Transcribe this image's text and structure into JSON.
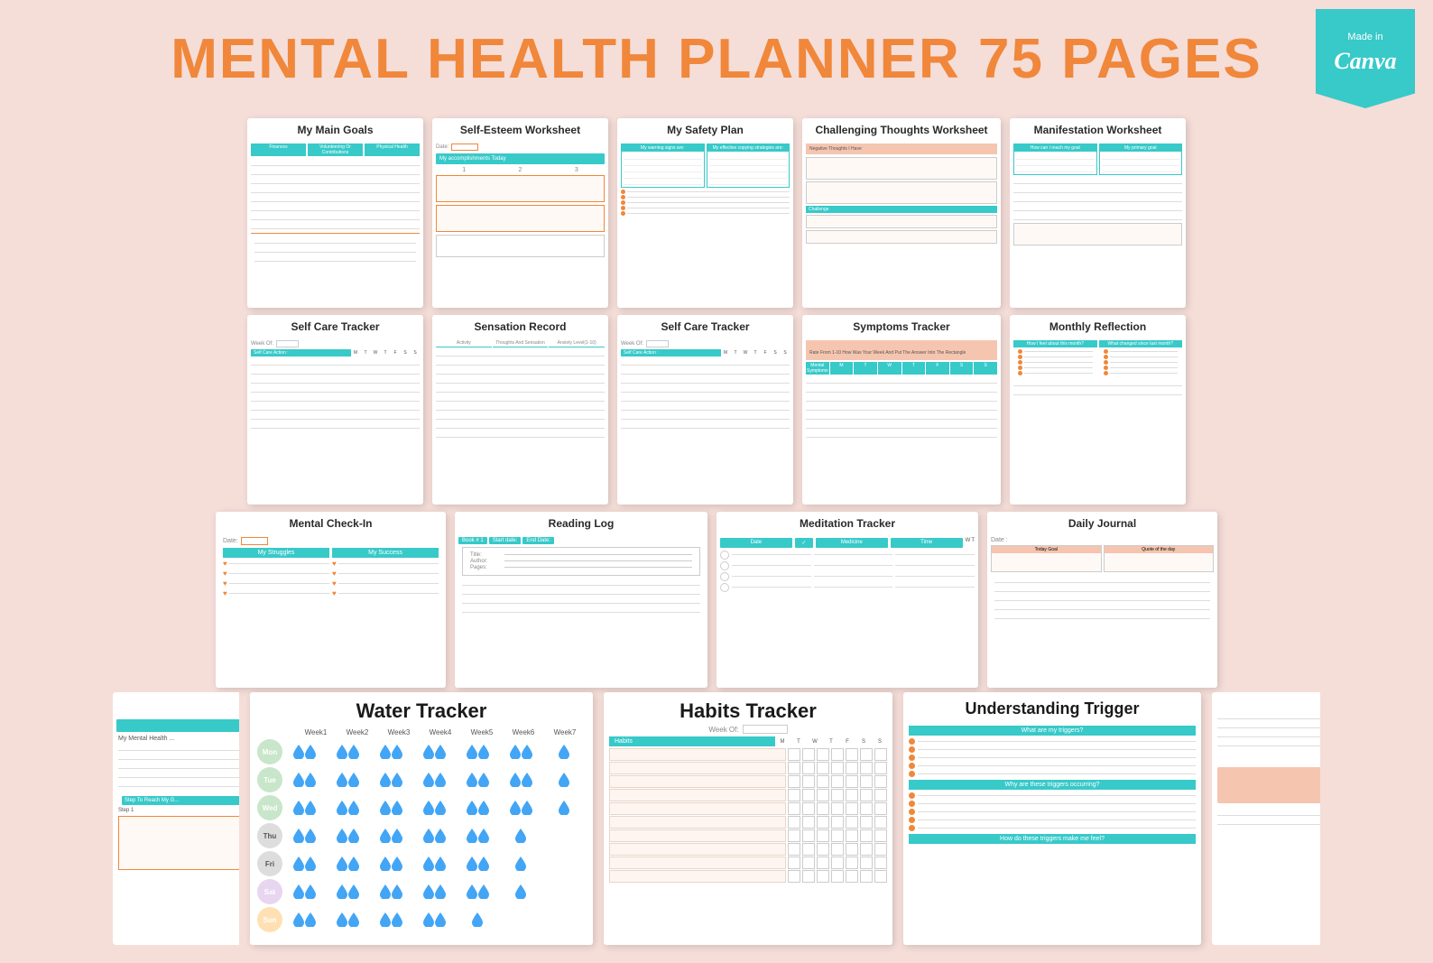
{
  "header": {
    "title_black": "MENTAL HEALTH PLANNER",
    "title_orange": "75 PAGES",
    "canva_badge": {
      "made_in": "Made in",
      "canva": "Canva"
    }
  },
  "cards": {
    "row1": [
      {
        "id": "my-main-goals",
        "title": "My Main Goals"
      },
      {
        "id": "self-esteem-worksheet",
        "title": "Self-Esteem Worksheet"
      },
      {
        "id": "my-safety-plan",
        "title": "My Safety Plan"
      },
      {
        "id": "challenging-thoughts",
        "title": "Challenging Thoughts Worksheet"
      },
      {
        "id": "manifestation-worksheet",
        "title": "Manifestation Worksheet"
      }
    ],
    "row2": [
      {
        "id": "self-care-tracker-1",
        "title": "Self Care Tracker"
      },
      {
        "id": "sensation-record",
        "title": "Sensation Record"
      },
      {
        "id": "self-care-tracker-2",
        "title": "Self Care Tracker"
      },
      {
        "id": "symptoms-tracker",
        "title": "Symptoms Tracker"
      },
      {
        "id": "monthly-reflection",
        "title": "Monthly Reflection"
      }
    ],
    "row3": [
      {
        "id": "mental-check-in",
        "title": "Mental Check-In"
      },
      {
        "id": "reading-log",
        "title": "Reading Log"
      },
      {
        "id": "meditation-tracker",
        "title": "Meditation Tracker"
      },
      {
        "id": "daily-journal",
        "title": "Daily Journal"
      }
    ],
    "row4": [
      {
        "id": "water-tracker",
        "title": "Water Tracker"
      },
      {
        "id": "habits-tracker",
        "title": "Habits Tracker"
      },
      {
        "id": "understanding-trigger",
        "title": "Understanding Trigger"
      }
    ]
  },
  "water_tracker": {
    "title": "Water Tracker",
    "weeks": [
      "Week1",
      "Week2",
      "Week3",
      "Week4",
      "Week5",
      "Week6",
      "Week7"
    ],
    "days": [
      "Mon",
      "Tue",
      "Wed",
      "Thu",
      "Fri",
      "Sat",
      "Sun"
    ]
  },
  "habits_tracker": {
    "title": "Habits Tracker",
    "week_of_label": "Week Of:",
    "habits_label": "Habits",
    "days": [
      "M",
      "T",
      "W",
      "T",
      "F",
      "S",
      "S"
    ]
  },
  "understanding_trigger": {
    "title": "Understanding Trigger",
    "question1": "What are my triggers?",
    "question2": "Why are these triggers occurring?",
    "question3": "How do these triggers make me feel?"
  },
  "symptoms_tracker": {
    "description": "Rate From 1-10 How Was Your Week And Put The Answer Into The Rectangle",
    "label": "Mental Symptoms"
  },
  "monthly_reflection": {
    "col1": "How I feel about this month?",
    "col2": "What changed since last month?"
  },
  "self_esteem": {
    "date_label": "Date:",
    "accomplishments_label": "My accomplishments Today",
    "numbers": [
      "1",
      "2",
      "3"
    ]
  },
  "safety_plan": {
    "col1_header": "My warning signs are:",
    "col2_header": "My effective copying strategies are:"
  },
  "manifestation": {
    "col1": "How can I reach my goal",
    "col2": "My primary goal"
  },
  "reading_log": {
    "book_label": "Book # 1",
    "start_label": "Start date:",
    "end_label": "End Date:",
    "fields": [
      "Title:",
      "Author:",
      "Pages:"
    ]
  },
  "meditation": {
    "col1": "Date",
    "col2": "Medicine",
    "col3": "Time"
  },
  "daily_journal": {
    "date_label": "Date :",
    "col1": "Today Goal",
    "col2": "Quote of the day"
  },
  "mental_checkin": {
    "date_label": "Date:",
    "col1": "My Struggles",
    "col2": "My Success"
  },
  "sensation_record": {
    "cols": [
      "Activity",
      "Thoughts And Sensation",
      "Anxiety Level(1-10)"
    ]
  },
  "self_care": {
    "week_label": "Week Of:",
    "action_label": "Self Care Action :",
    "days": [
      "M",
      "T",
      "W",
      "T",
      "F",
      "S",
      "S"
    ]
  },
  "goals": {
    "tabs": [
      "Finances",
      "Volunteering Or Contributions",
      "Physical Health"
    ]
  }
}
